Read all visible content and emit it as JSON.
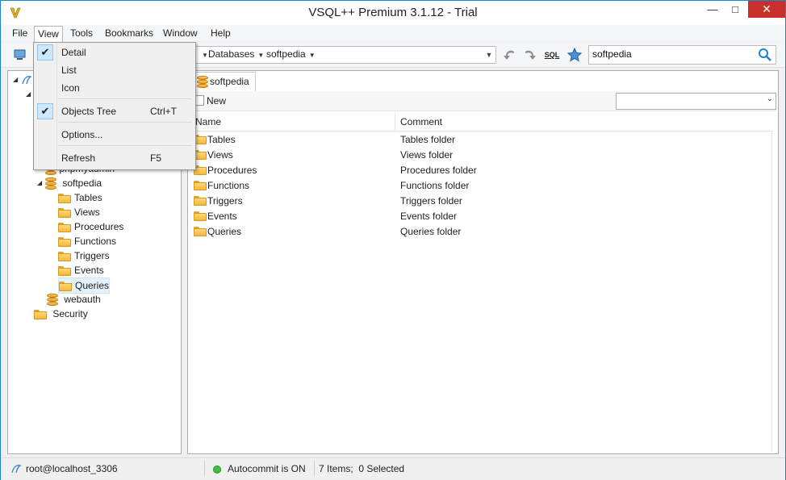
{
  "window": {
    "title": "VSQL++ Premium 3.1.12 - Trial",
    "minimize": "—",
    "maximize": "□",
    "close": "✕"
  },
  "menu": [
    "File",
    "View",
    "Tools",
    "Bookmarks",
    "Window",
    "Help"
  ],
  "toolbar": {
    "breadcrumb": [
      "Databases",
      "softpedia"
    ],
    "search_value": "softpedia",
    "sql_label": "SQL"
  },
  "view_menu": {
    "items": [
      {
        "label": "Detail",
        "checked": true,
        "shortcut": ""
      },
      {
        "label": "List",
        "checked": false,
        "shortcut": ""
      },
      {
        "label": "Icon",
        "checked": false,
        "shortcut": ""
      },
      {
        "label": "Objects Tree",
        "checked": true,
        "shortcut": "Ctrl+T"
      },
      {
        "label": "Options...",
        "checked": false,
        "shortcut": ""
      },
      {
        "label": "Refresh",
        "checked": false,
        "shortcut": "F5"
      }
    ]
  },
  "tree": {
    "visible_partial": "phpmyadmin",
    "database": "softpedia",
    "children": [
      "Tables",
      "Views",
      "Procedures",
      "Functions",
      "Triggers",
      "Events",
      "Queries"
    ],
    "after": [
      "webauth"
    ],
    "security": "Security"
  },
  "tab": {
    "label": "softpedia"
  },
  "new_button": "New",
  "grid": {
    "columns": [
      "Name",
      "Comment"
    ],
    "rows": [
      {
        "name": "Tables",
        "comment": "Tables folder"
      },
      {
        "name": "Views",
        "comment": "Views folder"
      },
      {
        "name": "Procedures",
        "comment": "Procedures folder"
      },
      {
        "name": "Functions",
        "comment": "Functions folder"
      },
      {
        "name": "Triggers",
        "comment": "Triggers folder"
      },
      {
        "name": "Events",
        "comment": "Events folder"
      },
      {
        "name": "Queries",
        "comment": "Queries folder"
      }
    ]
  },
  "status": {
    "connection": "root@localhost_3306",
    "autocommit": "Autocommit is ON",
    "items": "7 Items;  0 Selected"
  },
  "colors": {
    "accent": "#1983d4",
    "close": "#c7302b",
    "folder": "#f5b73a"
  }
}
